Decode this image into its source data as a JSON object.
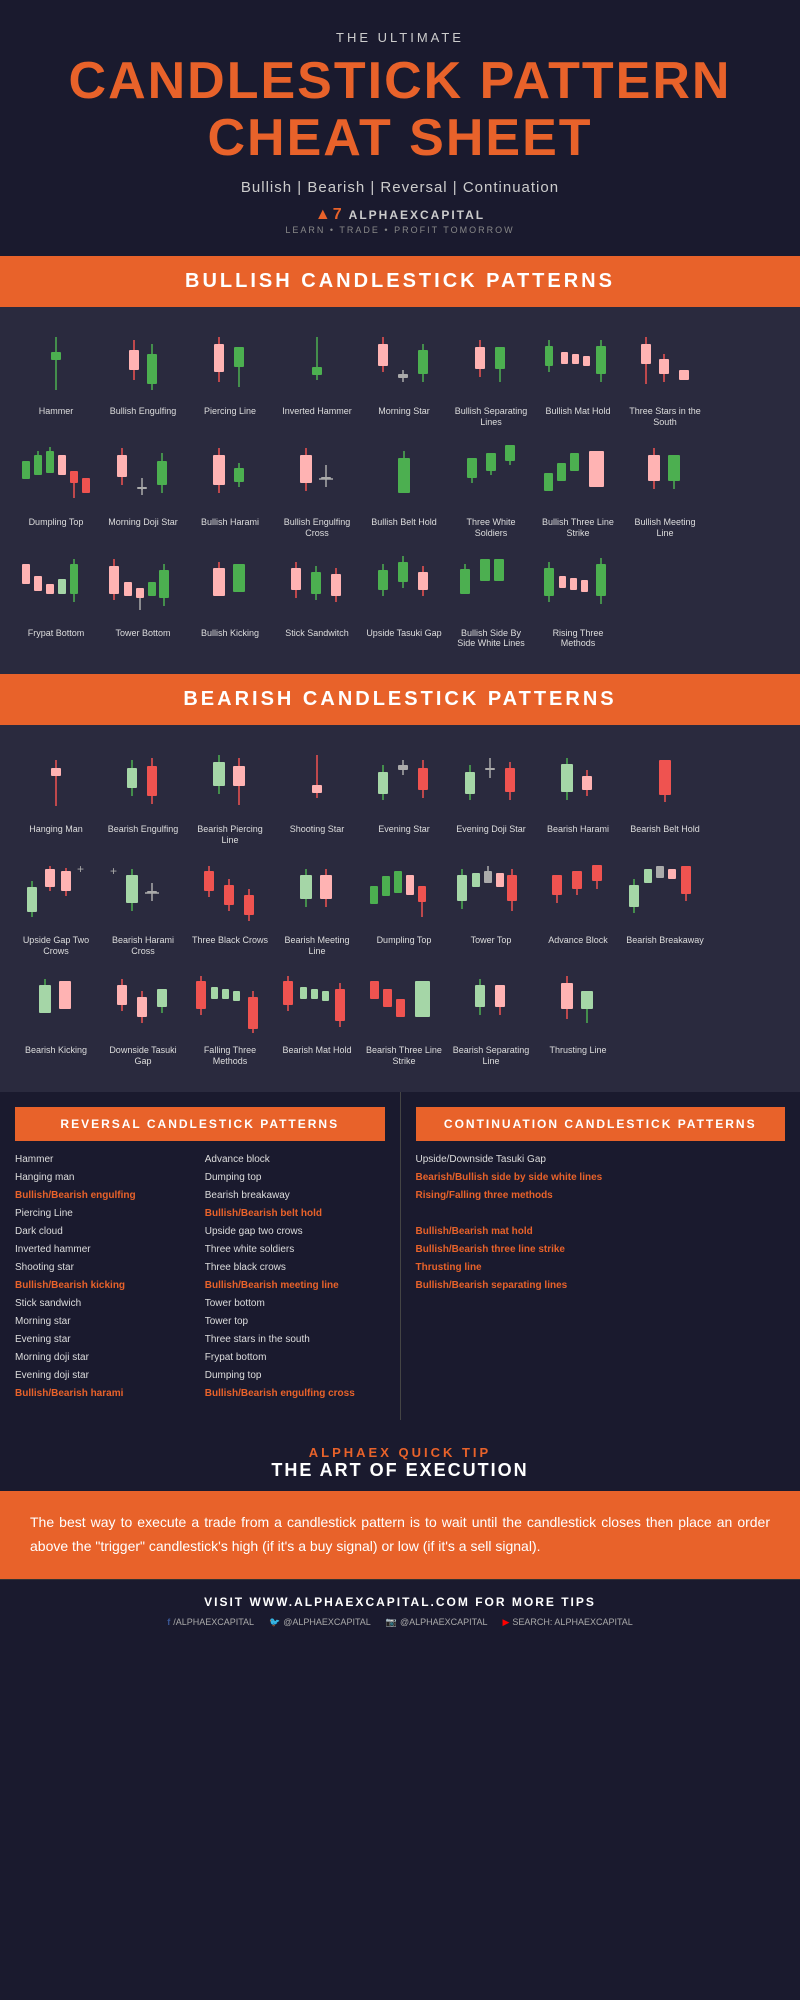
{
  "header": {
    "subtitle": "THE ULTIMATE",
    "main_title": "CANDLESTICK PATTERN\nCHEAT SHEET",
    "categories": "Bullish | Bearish | Reversal | Continuation",
    "logo": "A7 ALPHAEX CAPITAL",
    "tagline": "LEARN • TRADE • PROFIT TOMORROW"
  },
  "sections": {
    "bullish": {
      "title": "BULLISH CANDLESTICK PATTERNS",
      "patterns": [
        "Hammer",
        "Bullish Engulfing",
        "Piercing Line",
        "Inverted Hammer",
        "Morning Star",
        "Bullish Separating Lines",
        "Bullish Mat Hold",
        "Three Stars in the South",
        "Dumpling Top",
        "Morning Doji Star",
        "Bullish Harami",
        "Bullish Engulfing Cross",
        "Bullish Belt Hold",
        "Three White Soldiers",
        "Bullish Three Line Strike",
        "Bullish Meeting Line",
        "Frypat Bottom",
        "Tower Bottom",
        "Bullish Kicking",
        "Stick Sandwitch",
        "Upside Tasuki Gap",
        "Bullish Side By Side White Lines",
        "Rising Three Methods"
      ]
    },
    "bearish": {
      "title": "BEARISH CANDLESTICK PATTERNS",
      "patterns": [
        "Hanging Man",
        "Bearish Engulfing",
        "Bearish Piercing Line",
        "Shooting Star",
        "Evening Star",
        "Evening Doji Star",
        "Bearish Harami",
        "Bearish Belt Hold",
        "Upside Gap Two Crows",
        "Bearish Harami Cross",
        "Three Black Crows",
        "Bearish Meeting Line",
        "Dumpling Top",
        "Tower Top",
        "Advance Block",
        "Bearish Breakaway",
        "Bearish Kicking",
        "Downside Tasuki Gap",
        "Falling Three Methods",
        "Bearish Mat Hold",
        "Bearish Three Line Strike",
        "Bearish Separating Line",
        "Thrusting Line"
      ]
    },
    "reversal": {
      "title": "REVERSAL CANDLESTICK PATTERNS",
      "col1": [
        "Hammer",
        "Hanging man",
        "Bullish/Bearish engulfing",
        "Piercing Line",
        "Dark cloud",
        "Inverted hammer",
        "Shooting star",
        "Bullish/Bearish kicking",
        "Stick sandwich",
        "Morning star",
        "Evening star",
        "Morning doji star",
        "Evening doji star",
        "Bullish/Bearish harami"
      ],
      "col2": [
        "Advance block",
        "Dumping top",
        "Bearish breakaway",
        "Bullish/Bearish belt hold",
        "Upside gap two crows",
        "Three white soldiers",
        "Three black crows",
        "Bullish/Bearish meeting line",
        "Tower bottom",
        "Tower top",
        "Three stars in the south",
        "Frypat bottom",
        "Dumping top",
        "Bullish/Bearish engulfing cross"
      ]
    },
    "continuation": {
      "title": "CONTINUATION CANDLESTICK PATTERNS",
      "col1": [
        "Upside/Downside Tasuki Gap",
        "Bearish/Bullish side by side white lines",
        "Rising/Falling three methods",
        "",
        "Bullish/Bearish mat hold",
        "Bullish/Bearish three line strike",
        "Thrusting line",
        "Bullish/Bearish separating lines"
      ],
      "highlighted": [
        2,
        5,
        6,
        7
      ]
    }
  },
  "quick_tip": {
    "label": "ALPHAEX QUICK TIP",
    "subtitle": "THE ART OF EXECUTION",
    "body": "The best way to execute a trade from a candlestick pattern is to wait until the candlestick closes then place an order above the \"trigger\" candlestick's high (if it's a buy signal) or low (if it's a sell signal)."
  },
  "footer": {
    "cta": "VISIT WWW.ALPHAEXCAPITAL.COM FOR MORE TIPS",
    "social": [
      {
        "platform": "facebook",
        "handle": "/ALPHAEXCAPITAL"
      },
      {
        "platform": "twitter",
        "handle": "@ALPHAEXCAPITAL"
      },
      {
        "platform": "instagram",
        "handle": "@ALPHAEXCAPITAL"
      },
      {
        "platform": "youtube",
        "handle": "SEARCH: ALPHAEXCAPITAL"
      }
    ]
  }
}
